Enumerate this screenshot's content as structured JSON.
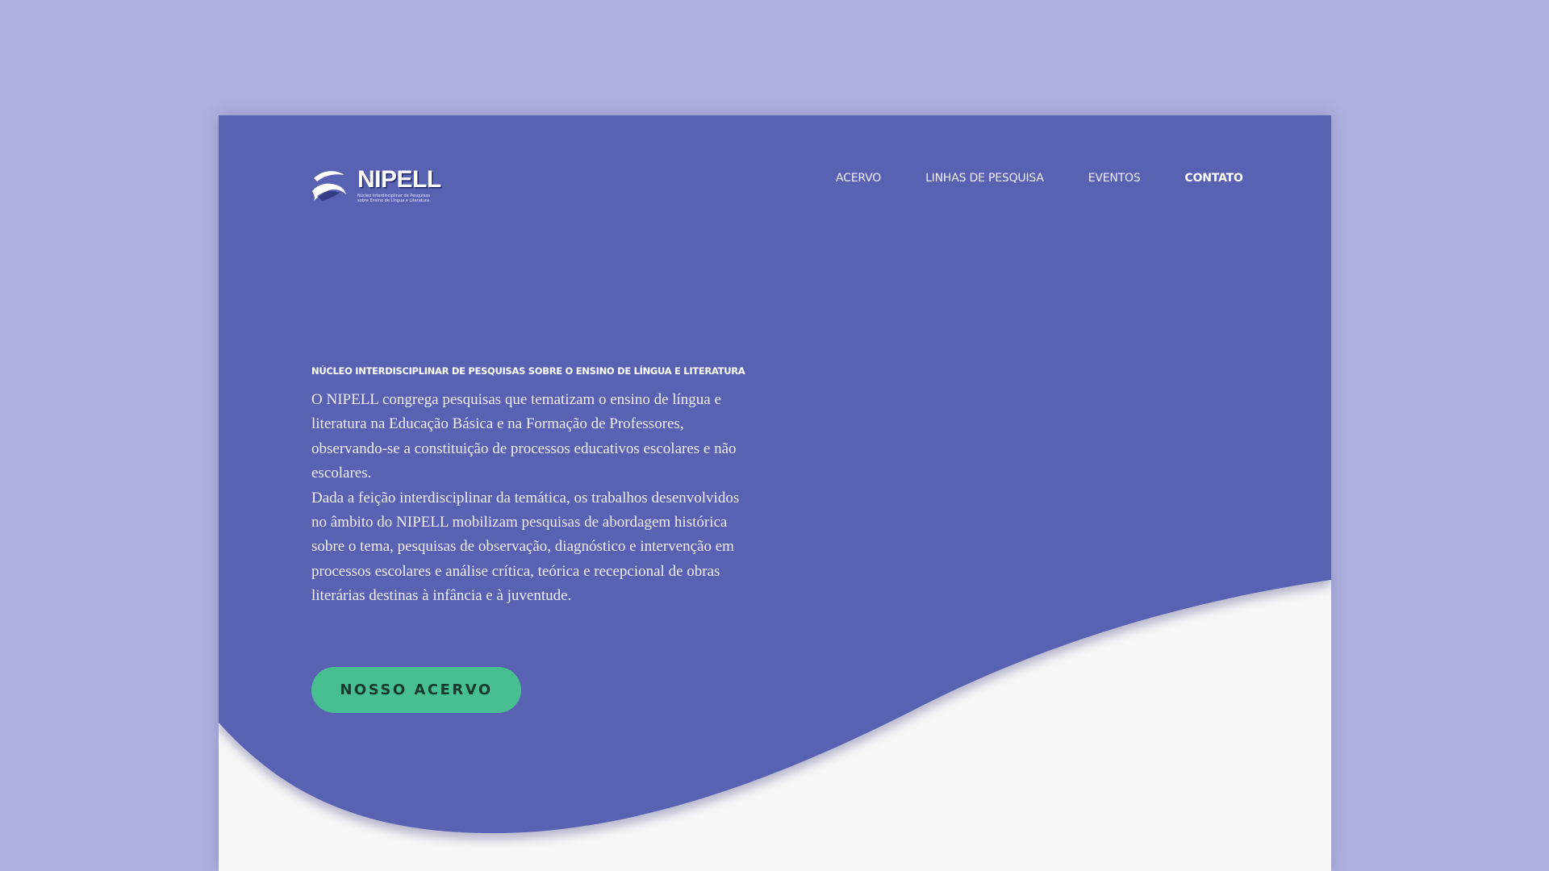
{
  "brand": {
    "name": "NIPELL",
    "tagline": "Núcleo Interdisciplinar de Pesquisas sobre Ensino de Língua e Literatura",
    "logo_icon": "wave-book-icon"
  },
  "nav": {
    "items": [
      {
        "label": "ACERVO"
      },
      {
        "label": "LINHAS DE PESQUISA"
      },
      {
        "label": "EVENTOS"
      },
      {
        "label": "CONTATO"
      }
    ]
  },
  "hero": {
    "kicker": "NÚCLEO INTERDISCIPLINAR DE PESQUISAS SOBRE O ENSINO DE LÍNGUA E LITERATURA",
    "paragraph_1": "O NIPELL congrega pesquisas que tematizam o ensino de língua e literatura na Educação Básica e na Formação de Professores, observando-se a constituição de processos educativos escolares e não escolares.",
    "paragraph_2": "Dada a feição interdisciplinar da temática, os trabalhos desenvolvidos no âmbito do NIPELL mobilizam pesquisas de abordagem histórica sobre o tema, pesquisas de observação, diagnóstico e intervenção em processos escolares e análise crítica, teórica e recepcional de obras literárias destinas à infância e à juventude.",
    "cta_label": "NOSSO ACERVO"
  },
  "colors": {
    "page_background": "#aeb0de",
    "hero": "#5961b3",
    "content_background": "#f7f7f7",
    "cta": "#48bf91",
    "cta_text": "#143a2c",
    "text": "#ffffff"
  }
}
